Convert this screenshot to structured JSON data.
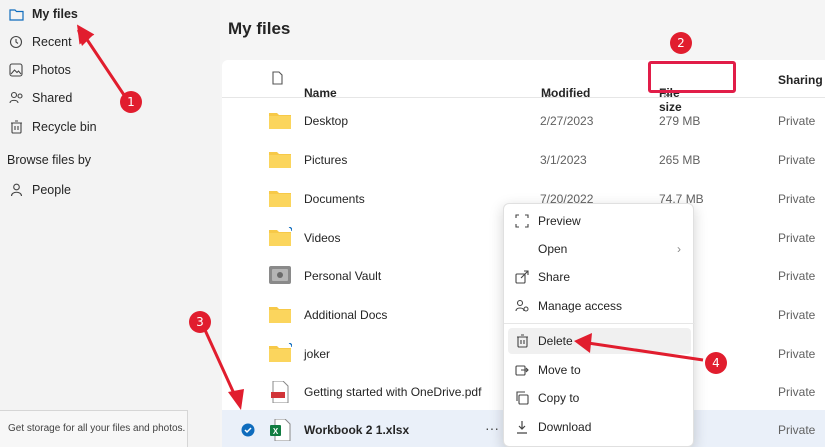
{
  "sidebar": {
    "items": [
      {
        "label": "My files",
        "icon": "folder-icon"
      },
      {
        "label": "Recent",
        "icon": "history-icon"
      },
      {
        "label": "Photos",
        "icon": "photo-icon"
      },
      {
        "label": "Shared",
        "icon": "people-icon"
      },
      {
        "label": "Recycle bin",
        "icon": "trash-icon"
      }
    ],
    "browse_title": "Browse files by",
    "people_label": "People",
    "storage_text": "Get storage for all your files and photos."
  },
  "main": {
    "title": "My files",
    "columns": {
      "name": "Name",
      "modified": "Modified",
      "size": "File size",
      "size_sort": "↓",
      "sharing": "Sharing"
    },
    "rows": [
      {
        "name": "Desktop",
        "modified": "2/27/2023",
        "size": "279 MB",
        "sharing": "Private"
      },
      {
        "name": "Pictures",
        "modified": "3/1/2023",
        "size": "265 MB",
        "sharing": "Private"
      },
      {
        "name": "Documents",
        "modified": "7/20/2022",
        "size": "74.7 MB",
        "sharing": "Private"
      },
      {
        "name": "Videos",
        "modified": "",
        "size": "",
        "sharing": "Private"
      },
      {
        "name": "Personal Vault",
        "modified": "",
        "size": "",
        "sharing": "Private"
      },
      {
        "name": "Additional Docs",
        "modified": "",
        "size": "",
        "sharing": "Private"
      },
      {
        "name": "joker",
        "modified": "",
        "size": "",
        "sharing": "Private"
      },
      {
        "name": "Getting started with OneDrive.pdf",
        "modified": "",
        "size": "",
        "sharing": "Private"
      },
      {
        "name": "Workbook 2 1.xlsx",
        "modified": "",
        "size": "",
        "sharing": "Private"
      }
    ],
    "more_label": "···"
  },
  "context_menu": {
    "items": [
      "Preview",
      "Open",
      "Share",
      "Manage access",
      "Delete",
      "Move to",
      "Copy to",
      "Download"
    ]
  },
  "annotations": [
    "1",
    "2",
    "3",
    "4"
  ],
  "colors": {
    "accent": "#0f6cbd",
    "annotation": "#e11d2e",
    "folder": "#f7c948"
  }
}
